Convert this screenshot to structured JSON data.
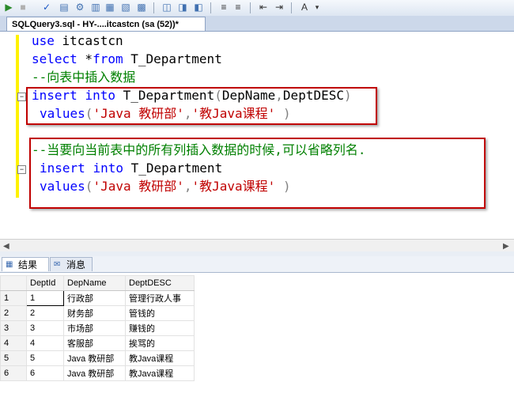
{
  "toolbar": {
    "icons": [
      "execute-icon",
      "stop-icon",
      "check-icon",
      "display-plan-icon",
      "query-options-icon",
      "results-to-text-icon",
      "results-to-grid-icon",
      "results-to-file-icon",
      "comment-icon",
      "uncomment-icon",
      "indent-icon",
      "outdent-icon",
      "specify-values-icon"
    ]
  },
  "tab": {
    "title": "SQLQuery3.sql - HY-....itcastcn (sa (52))*"
  },
  "editor": {
    "lines": [
      {
        "kw1": "use",
        "tx1": " itcastcn"
      },
      {
        "kw1": "select",
        "tx1": " *",
        "kw2": "from",
        "tx2": " T_Department"
      },
      {
        "cm": "--向表中插入数据"
      },
      {
        "kw1": "insert",
        "sp": " ",
        "kw2": "into",
        "tx1": " T_Department",
        "gr1": "(",
        "tx2": "DepName",
        "gr2": ",",
        "tx3": "DeptDESC",
        "gr3": ")"
      },
      {
        "kw1": "values",
        "gr1": "(",
        "st1": "'Java 教研部'",
        "gr2": ",",
        "st2": "'教Java课程'",
        "gr3": " )"
      },
      {
        "cm": "--当要向当前表中的所有列插入数据的时候,可以省略列名."
      },
      {
        "kw1": "insert",
        "sp": " ",
        "kw2": "into",
        "tx1": " T_Department"
      },
      {
        "kw1": "values",
        "gr1": "(",
        "st1": "'Java 教研部'",
        "gr2": ",",
        "st2": "'教Java课程'",
        "gr3": " )"
      }
    ]
  },
  "results": {
    "tabs": [
      {
        "label": "结果",
        "icon": "grid-icon"
      },
      {
        "label": "消息",
        "icon": "messages-icon"
      }
    ],
    "columns": [
      "DeptId",
      "DepName",
      "DeptDESC"
    ],
    "rows": [
      {
        "num": "1",
        "cells": [
          "1",
          "行政部",
          "管理行政人事"
        ]
      },
      {
        "num": "2",
        "cells": [
          "2",
          "财务部",
          "管钱的"
        ]
      },
      {
        "num": "3",
        "cells": [
          "3",
          "市场部",
          "赚钱的"
        ]
      },
      {
        "num": "4",
        "cells": [
          "4",
          "客服部",
          "挨骂的"
        ]
      },
      {
        "num": "5",
        "cells": [
          "5",
          "Java 教研部",
          "教Java课程"
        ]
      },
      {
        "num": "6",
        "cells": [
          "6",
          "Java 教研部",
          "教Java课程"
        ]
      }
    ]
  },
  "colors": {
    "keyword": "#0000ff",
    "comment": "#008000",
    "string": "#c00000",
    "highlight_box": "#c00000",
    "change_bar": "#fff200"
  }
}
